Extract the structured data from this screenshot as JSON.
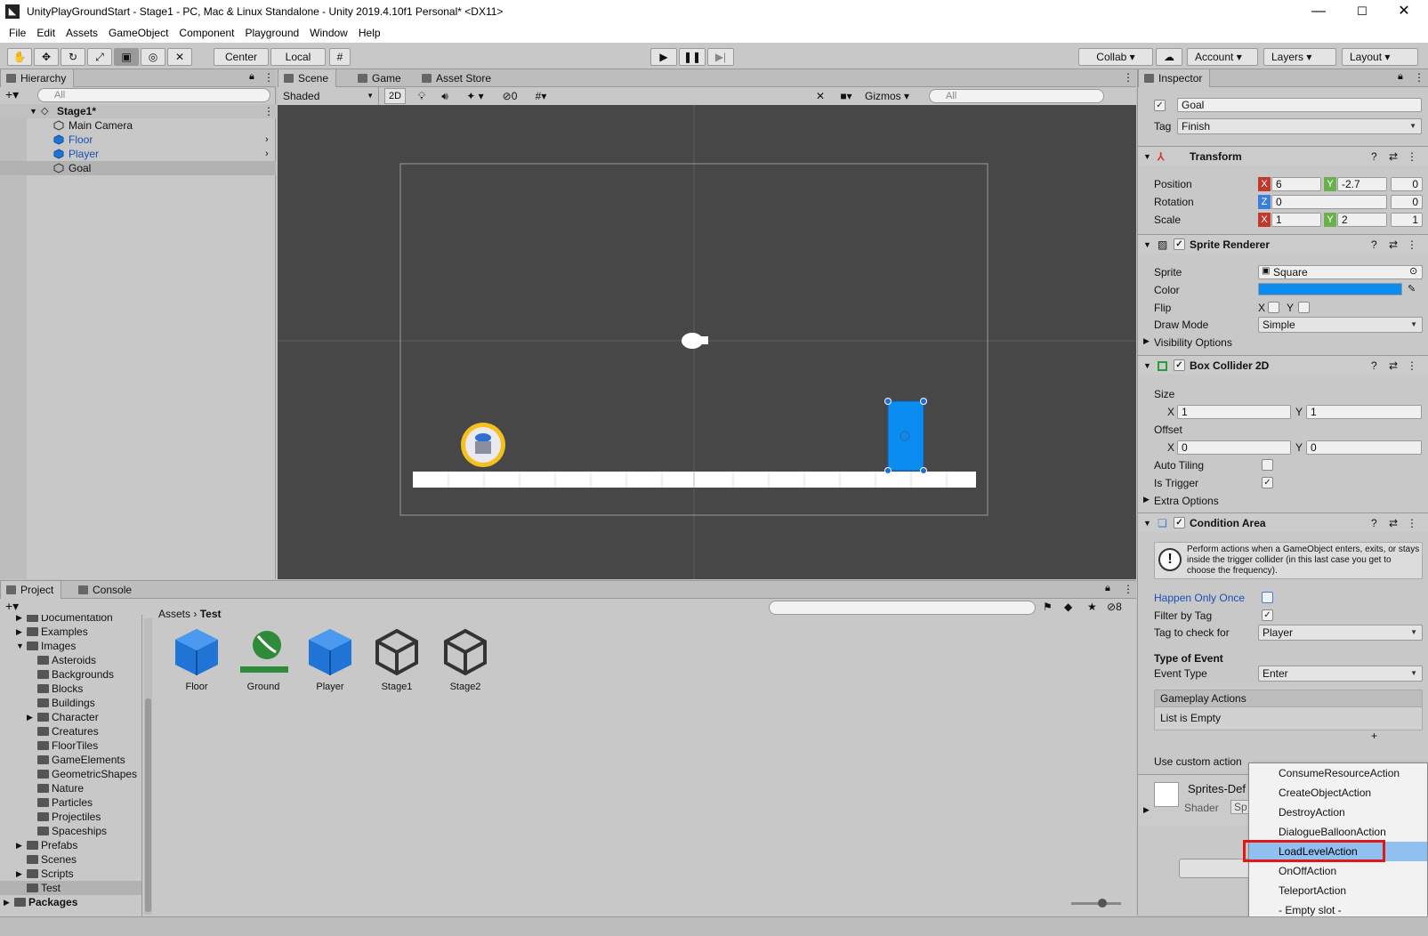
{
  "window": {
    "title": "UnityPlayGroundStart - Stage1 - PC, Mac & Linux Standalone - Unity 2019.4.10f1 Personal* <DX11>",
    "minimize": "—",
    "maximize": "☐",
    "close": "✕"
  },
  "menu": [
    "File",
    "Edit",
    "Assets",
    "GameObject",
    "Component",
    "Playground",
    "Window",
    "Help"
  ],
  "toolbar": {
    "pivot": "Center",
    "space": "Local",
    "collab": "Collab ▾",
    "account": "Account",
    "layers": "Layers",
    "layout": "Layout"
  },
  "hierarchy": {
    "tab": "Hierarchy",
    "search_placeholder": "All",
    "scene": "Stage1*",
    "items": [
      {
        "label": "Main Camera",
        "color": "#111111"
      },
      {
        "label": "Floor",
        "color": "#1a4fb5"
      },
      {
        "label": "Player",
        "color": "#1a4fb5"
      },
      {
        "label": "Goal",
        "color": "#111111"
      }
    ]
  },
  "scene": {
    "tabs": [
      "Scene",
      "Game",
      "Asset Store"
    ],
    "shading": "Shaded",
    "mode2d": "2D",
    "hidden_count": "0",
    "gizmos": "Gizmos",
    "search_placeholder": "All"
  },
  "inspector": {
    "tab": "Inspector",
    "name": "Goal",
    "tag_label": "Tag",
    "tag": "Finish",
    "transform": {
      "title": "Transform",
      "position_label": "Position",
      "pos_x": "6",
      "pos_y": "-2.7",
      "pos_z": "0",
      "rotation_label": "Rotation",
      "rot_z": "0",
      "rot_extra": "0",
      "scale_label": "Scale",
      "scale_x": "1",
      "scale_y": "2",
      "scale_z": "1"
    },
    "sprite_renderer": {
      "title": "Sprite Renderer",
      "sprite_label": "Sprite",
      "sprite": "Square",
      "color_label": "Color",
      "color": "#0a8cf0",
      "flip_label": "Flip",
      "flip_x": "X",
      "flip_y": "Y",
      "draw_mode_label": "Draw Mode",
      "draw_mode": "Simple",
      "visibility": "Visibility Options"
    },
    "box_collider": {
      "title": "Box Collider 2D",
      "size_label": "Size",
      "size_x": "1",
      "size_y": "1",
      "offset_label": "Offset",
      "off_x": "0",
      "off_y": "0",
      "x": "X",
      "y": "Y",
      "auto_tiling": "Auto Tiling",
      "is_trigger": "Is Trigger",
      "is_trigger_checked": "✓",
      "extra": "Extra Options"
    },
    "condition_area": {
      "title": "Condition Area",
      "info": "Perform actions when a GameObject enters, exits, or stays inside the trigger collider (in this last case you get to choose the frequency).",
      "happen_once": "Happen Only Once",
      "filter_tag": "Filter by Tag",
      "filter_checked": "✓",
      "tag_check_label": "Tag to check for",
      "tag_check": "Player",
      "type_event": "Type of Event",
      "event_type_label": "Event Type",
      "event_type": "Enter",
      "gameplay_actions": "Gameplay Actions",
      "list_empty": "List is Empty",
      "use_custom": "Use custom action",
      "material": "Sprites-Def",
      "shader_label": "Shader",
      "shader": "Sp"
    }
  },
  "popup": {
    "items": [
      "ConsumeResourceAction",
      "CreateObjectAction",
      "DestroyAction",
      "DialogueBalloonAction",
      "LoadLevelAction",
      "OnOffAction",
      "TeleportAction",
      "- Empty slot -"
    ],
    "selected": "LoadLevelAction"
  },
  "project": {
    "tabs": [
      "Project",
      "Console"
    ],
    "hidden_count": "8",
    "breadcrumb_root": "Assets",
    "breadcrumb_current": "Test",
    "tree": [
      {
        "label": "Documentation",
        "indent": 1,
        "arrow": "▶"
      },
      {
        "label": "Examples",
        "indent": 1,
        "arrow": "▶"
      },
      {
        "label": "Images",
        "indent": 1,
        "arrow": "▼"
      },
      {
        "label": "Asteroids",
        "indent": 2,
        "arrow": ""
      },
      {
        "label": "Backgrounds",
        "indent": 2,
        "arrow": ""
      },
      {
        "label": "Blocks",
        "indent": 2,
        "arrow": ""
      },
      {
        "label": "Buildings",
        "indent": 2,
        "arrow": ""
      },
      {
        "label": "Character",
        "indent": 2,
        "arrow": "▶"
      },
      {
        "label": "Creatures",
        "indent": 2,
        "arrow": ""
      },
      {
        "label": "FloorTiles",
        "indent": 2,
        "arrow": ""
      },
      {
        "label": "GameElements",
        "indent": 2,
        "arrow": ""
      },
      {
        "label": "GeometricShapes",
        "indent": 2,
        "arrow": ""
      },
      {
        "label": "Nature",
        "indent": 2,
        "arrow": ""
      },
      {
        "label": "Particles",
        "indent": 2,
        "arrow": ""
      },
      {
        "label": "Projectiles",
        "indent": 2,
        "arrow": ""
      },
      {
        "label": "Spaceships",
        "indent": 2,
        "arrow": ""
      },
      {
        "label": "Prefabs",
        "indent": 1,
        "arrow": "▶"
      },
      {
        "label": "Scenes",
        "indent": 1,
        "arrow": ""
      },
      {
        "label": "Scripts",
        "indent": 1,
        "arrow": "▶"
      },
      {
        "label": "Test",
        "indent": 1,
        "arrow": ""
      },
      {
        "label": "Packages",
        "indent": 0,
        "arrow": "▶"
      }
    ],
    "assets": [
      {
        "label": "Floor",
        "icon": "prefab-cube-icon"
      },
      {
        "label": "Ground",
        "icon": "ground-prefab-icon"
      },
      {
        "label": "Player",
        "icon": "prefab-cube-icon"
      },
      {
        "label": "Stage1",
        "icon": "unity-scene-icon"
      },
      {
        "label": "Stage2",
        "icon": "unity-scene-icon"
      }
    ]
  }
}
